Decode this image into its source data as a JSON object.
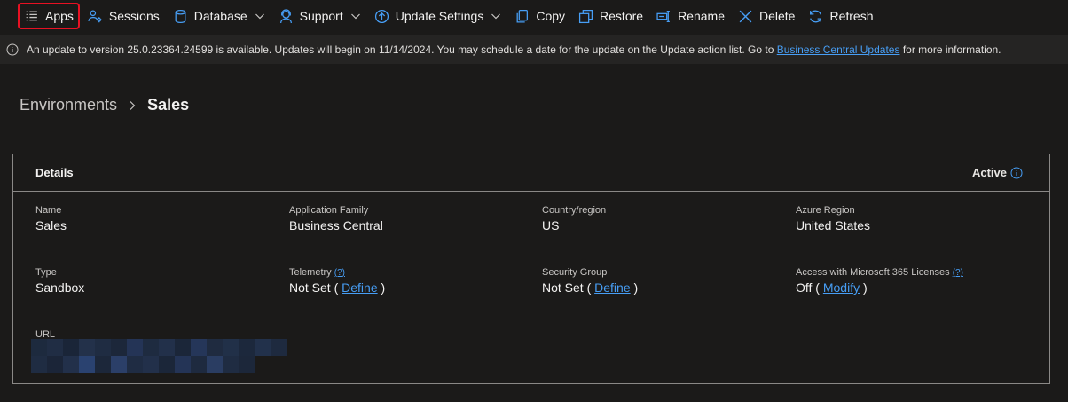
{
  "toolbar": {
    "apps": "Apps",
    "sessions": "Sessions",
    "database": "Database",
    "support": "Support",
    "update_settings": "Update Settings",
    "copy": "Copy",
    "restore": "Restore",
    "rename": "Rename",
    "delete": "Delete",
    "refresh": "Refresh"
  },
  "infobar": {
    "text": "An update to version 25.0.23364.24599 is available. Updates will begin on 11/14/2024. You may schedule a date for the update on the Update action list. Go to",
    "link": "Business Central Updates",
    "suffix": "for more information."
  },
  "breadcrumb": {
    "parent": "Environments",
    "current": "Sales"
  },
  "details": {
    "title": "Details",
    "status": "Active",
    "name_label": "Name",
    "name_value": "Sales",
    "family_label": "Application Family",
    "family_value": "Business Central",
    "country_label": "Country/region",
    "country_value": "US",
    "azure_label": "Azure Region",
    "azure_value": "United States",
    "type_label": "Type",
    "type_value": "Sandbox",
    "telemetry_label": "Telemetry",
    "telemetry_help": "(?)",
    "telemetry_value": "Not Set (",
    "telemetry_link": "Define",
    "security_label": "Security Group",
    "security_value": "Not Set (",
    "security_link": "Define",
    "access_label": "Access with Microsoft 365 Licenses",
    "access_help": "(?)",
    "access_value": "Off (",
    "access_link": "Modify",
    "close_paren": ")",
    "url_label": "URL"
  }
}
